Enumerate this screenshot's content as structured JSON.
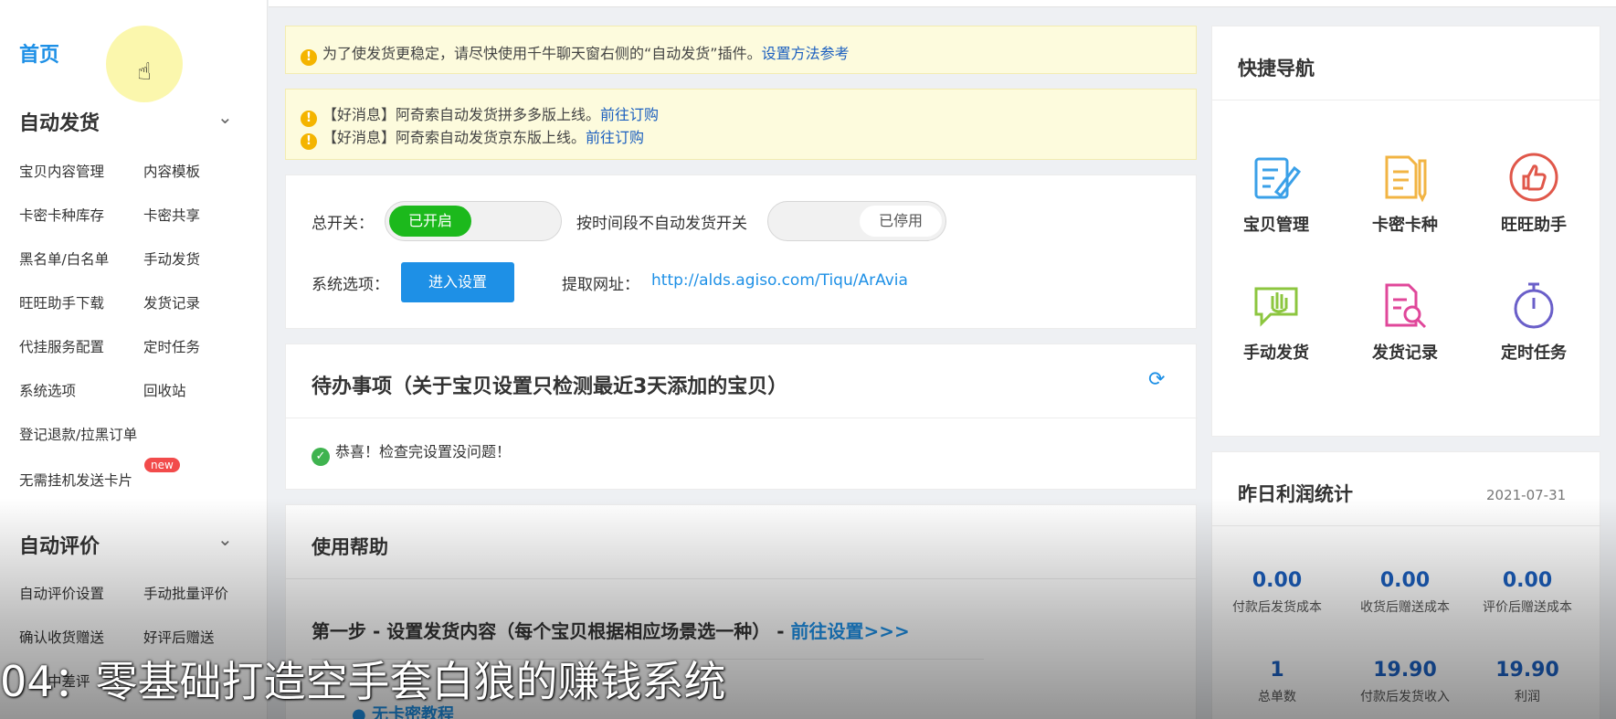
{
  "sidebar": {
    "home": "首页",
    "auto_ship": {
      "title": "自动发货",
      "items": [
        "宝贝内容管理",
        "内容模板",
        "卡密卡种库存",
        "卡密共享",
        "黑名单/白名单",
        "手动发货",
        "旺旺助手下载",
        "发货记录",
        "代挂服务配置",
        "定时任务",
        "系统选项",
        "回收站",
        "登记退款/拉黑订单",
        "无需挂机发送卡片"
      ],
      "new_badge": "new"
    },
    "auto_review": {
      "title": "自动评价",
      "items": [
        "自动评价设置",
        "手动批量评价",
        "确认收货赠送",
        "好评后赠送",
        "中差评"
      ]
    }
  },
  "notices": {
    "notice1_text": "为了使发货更稳定，请尽快使用千牛聊天窗右侧的“自动发货”插件。",
    "notice1_link": "设置方法参考",
    "notice2_line1": "【好消息】阿奇索自动发货拼多多版上线。",
    "notice2_line2": "【好消息】阿奇索自动发货京东版上线。",
    "notice2_link": "前往订购"
  },
  "settings": {
    "master_label": "总开关：",
    "master_state": "已开启",
    "period_label": "按时间段不自动发货开关",
    "period_state": "已停用",
    "sys_label": "系统选项：",
    "sys_button": "进入设置",
    "url_label": "提取网址：",
    "url_value": "http://alds.agiso.com/Tiqu/ArAvia"
  },
  "todo": {
    "title": "待办事项（关于宝贝设置只检测最近3天添加的宝贝）",
    "message": "恭喜！检查完设置没问题！"
  },
  "help": {
    "title": "使用帮助",
    "step1": "第一步 - 设置发货内容（每个宝贝根据相应场景选一种） -",
    "step1_link": "前往设置>>>",
    "bullet1": "● 无卡密教程"
  },
  "quick_nav": {
    "title": "快捷导航",
    "items": [
      {
        "label": "宝贝管理",
        "icon": "edit-document-icon",
        "color": "#3aa0e8"
      },
      {
        "label": "卡密卡种",
        "icon": "card-document-icon",
        "color": "#f2b443"
      },
      {
        "label": "旺旺助手",
        "icon": "thumbs-up-icon",
        "color": "#e0574a"
      },
      {
        "label": "手动发货",
        "icon": "hand-chat-icon",
        "color": "#8cc63f"
      },
      {
        "label": "发货记录",
        "icon": "search-document-icon",
        "color": "#e0479a"
      },
      {
        "label": "定时任务",
        "icon": "stopwatch-icon",
        "color": "#6a5fc9"
      }
    ]
  },
  "profit": {
    "title": "昨日利润统计",
    "date": "2021-07-31",
    "stats": [
      {
        "value": "0.00",
        "label": "付款后发货成本"
      },
      {
        "value": "0.00",
        "label": "收货后赠送成本"
      },
      {
        "value": "0.00",
        "label": "评价后赠送成本"
      },
      {
        "value": "1",
        "label": "总单数"
      },
      {
        "value": "19.90",
        "label": "付款后发货收入"
      },
      {
        "value": "19.90",
        "label": "利润"
      }
    ]
  },
  "caption": "04：零基础打造空手套白狼的赚钱系统",
  "colors": {
    "accent": "#1e90e6",
    "toggle_on": "#1cb91c",
    "badge": "#f24b4b"
  }
}
